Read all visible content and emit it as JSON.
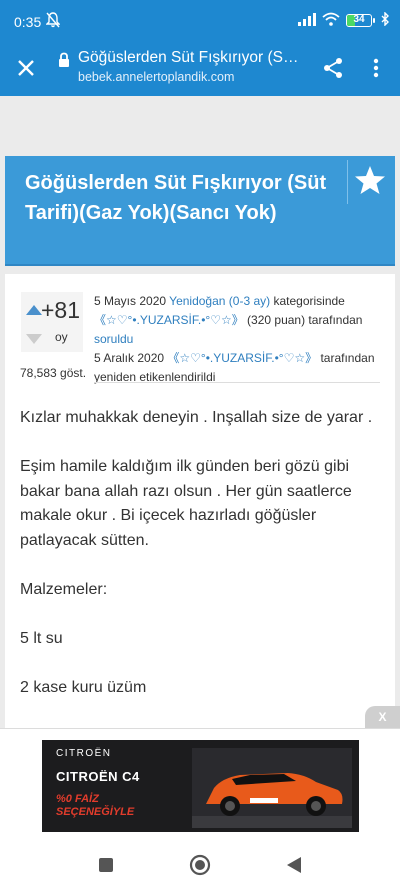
{
  "status_bar": {
    "time": "0:35",
    "battery": "34",
    "battery_level": 0.34,
    "icons": [
      "bell-off-icon",
      "signal-icon",
      "wifi-icon",
      "battery-icon",
      "bluetooth-icon"
    ]
  },
  "browser": {
    "title": "Göğüslerden Süt Fışkırıyor (S…",
    "url": "bebek.annelertoplandik.com",
    "icons": [
      "close-icon",
      "lock-icon",
      "share-icon",
      "more-vert-icon"
    ]
  },
  "article": {
    "title": "Göğüslerden Süt Fışkırıyor (Süt Tarifi)(Gaz Yok)(Sancı Yok)",
    "votes": "+81",
    "votes_label": "oy",
    "views": "78,583 göst.",
    "meta": {
      "date1": "5 Mayıs 2020",
      "category": "Yenidoğan (0-3 ay)",
      "category_suffix": " kategorisinde",
      "author1": "《☆♡°•.YUZARSİF.•°♡☆》",
      "points": " (320 puan) tarafından",
      "asked": "soruldu",
      "date2": "5 Aralık 2020",
      "author2": "《☆♡°•.YUZARSİF.•°♡☆》",
      "retag_suffix": " tarafından yeniden etikenlendirildi"
    },
    "paragraphs": [
      "Kızlar muhakkak deneyin . Inşallah size de yarar .",
      "Eşim hamile kaldığım ilk günden beri gözü gibi bakar bana allah razı olsun . Her gün saatlerce makale okur . Bi içecek hazırladı göğüsler patlayacak sütten.",
      "Malzemeler:",
      "5 lt su",
      "2  kase kuru üzüm"
    ]
  },
  "ad": {
    "close": "X",
    "brand": "CITROËN",
    "model": "CITROËN C4",
    "rate": "%0 FAİZ",
    "option": "SEÇENEĞİYLE"
  },
  "colors": {
    "header_blue": "#1e88d0",
    "title_blue": "#3b9ad8",
    "link": "#2f7fbf",
    "ad_red": "#e23c2c"
  }
}
